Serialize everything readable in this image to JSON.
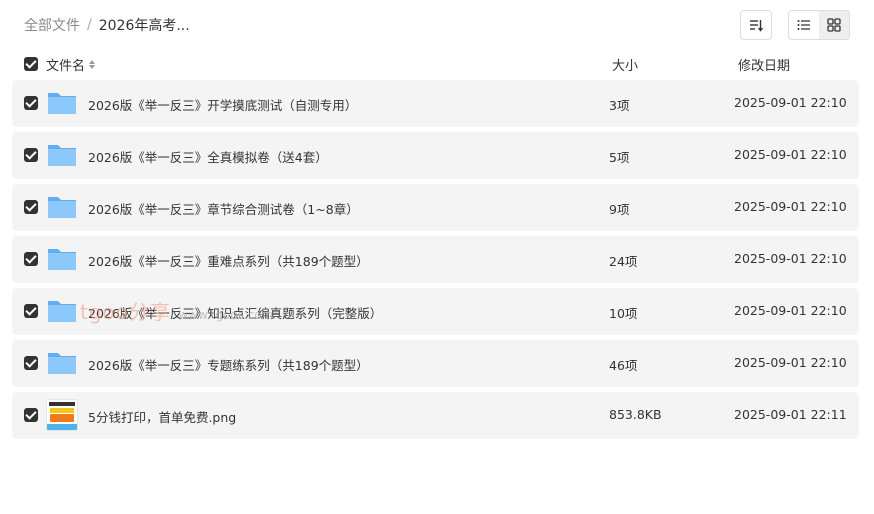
{
  "breadcrumb": {
    "root": "全部文件",
    "separator": "/",
    "current": "2026年高考..."
  },
  "columns": {
    "name": "文件名",
    "size": "大小",
    "date": "修改日期"
  },
  "files": [
    {
      "name": "2026版《举一反三》开学摸底测试（自测专用）",
      "size": "3项",
      "date": "2025-09-01 22:10",
      "type": "folder",
      "checked": true
    },
    {
      "name": "2026版《举一反三》全真模拟卷（送4套）",
      "size": "5项",
      "date": "2025-09-01 22:10",
      "type": "folder",
      "checked": true
    },
    {
      "name": "2026版《举一反三》章节综合测试卷（1~8章）",
      "size": "9项",
      "date": "2025-09-01 22:10",
      "type": "folder",
      "checked": true
    },
    {
      "name": "2026版《举一反三》重难点系列（共189个题型）",
      "size": "24项",
      "date": "2025-09-01 22:10",
      "type": "folder",
      "checked": true
    },
    {
      "name": "2026版《举一反三》知识点汇编真题系列（完整版）",
      "size": "10项",
      "date": "2025-09-01 22:10",
      "type": "folder",
      "checked": true
    },
    {
      "name": "2026版《举一反三》专题练系列（共189个题型）",
      "size": "46项",
      "date": "2025-09-01 22:10",
      "type": "folder",
      "checked": true
    },
    {
      "name": "5分钱打印，首单免费.png",
      "size": "853.8KB",
      "date": "2025-09-01 22:11",
      "type": "image",
      "checked": true
    }
  ],
  "watermark": {
    "text": "tgoo分享",
    "sub": "www.tgoos.com"
  },
  "icons": {
    "folder": "folder-icon",
    "image": "image-thumbnail-icon",
    "sort": "sort-icon",
    "list_view": "list-view-icon",
    "grid_view": "grid-view-icon"
  },
  "colors": {
    "row_bg": "#f4f4f4",
    "folder": "#7cc1f7",
    "checkbox": "#333333"
  }
}
